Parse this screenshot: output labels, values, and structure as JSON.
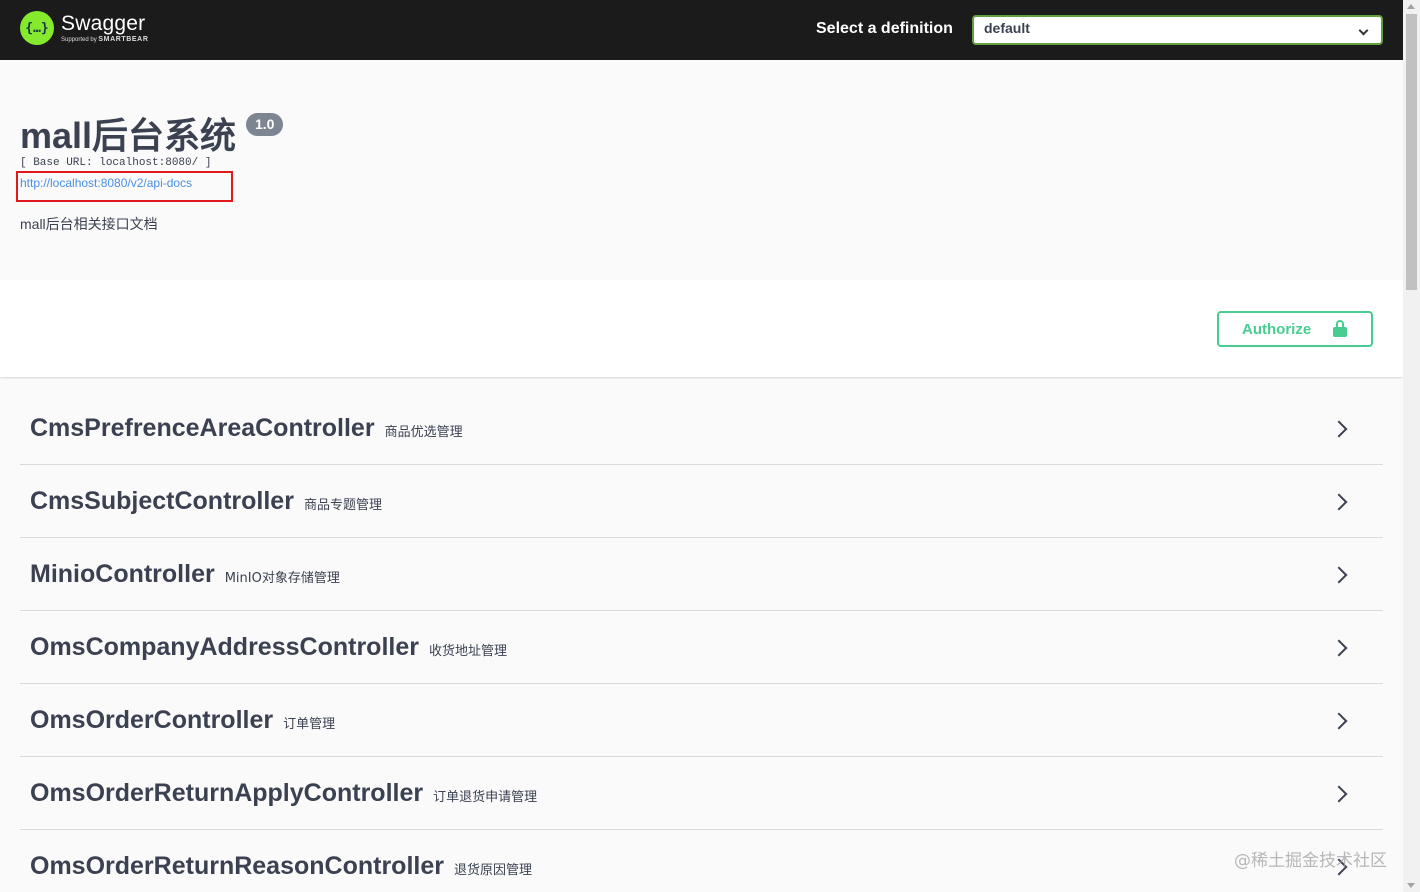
{
  "header": {
    "logo_title": "Swagger",
    "logo_sub_prefix": "Supported by",
    "logo_sub_brand": "SMARTBEAR",
    "definition_label": "Select a definition",
    "definition_selected": "default"
  },
  "info": {
    "title": "mall后台系统",
    "version": "1.0",
    "base_url": "[ Base URL: localhost:8080/ ]",
    "api_docs_link": "http://localhost:8080/v2/api-docs",
    "description": "mall后台相关接口文档"
  },
  "scheme": {
    "authorize_label": "Authorize"
  },
  "tags": [
    {
      "name": "CmsPrefrenceAreaController",
      "description": "商品优选管理"
    },
    {
      "name": "CmsSubjectController",
      "description": "商品专题管理"
    },
    {
      "name": "MinioController",
      "description": "MinIO对象存储管理"
    },
    {
      "name": "OmsCompanyAddressController",
      "description": "收货地址管理"
    },
    {
      "name": "OmsOrderController",
      "description": "订单管理"
    },
    {
      "name": "OmsOrderReturnApplyController",
      "description": "订单退货申请管理"
    },
    {
      "name": "OmsOrderReturnReasonController",
      "description": "退货原因管理"
    }
  ],
  "watermark": "@稀土掘金技术社区",
  "colors": {
    "topbar_bg": "#1b1b1b",
    "logo_green": "#85ea2d",
    "select_border": "#62a03f",
    "authorize_green": "#49cc90",
    "link_blue": "#4990e2",
    "highlight_red": "#e01a1a"
  }
}
